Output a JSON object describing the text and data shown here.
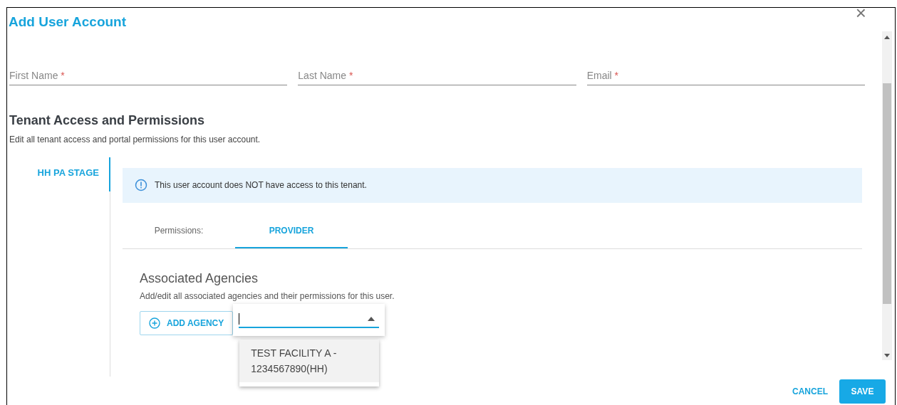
{
  "dialog": {
    "title": "Add User Account",
    "close_label": "×"
  },
  "fields": [
    {
      "label": "First Name",
      "required_mark": "*"
    },
    {
      "label": "Last Name",
      "required_mark": "*"
    },
    {
      "label": "Email",
      "required_mark": "*"
    }
  ],
  "section": {
    "title": "Tenant Access and Permissions",
    "description": "Edit all tenant access and portal permissions for this user account."
  },
  "tenants": [
    {
      "label": "HH PA STAGE",
      "selected": true
    }
  ],
  "notice": "This user account does NOT have access to this tenant.",
  "permission_tabs": {
    "caption": "Permissions:",
    "tabs": [
      {
        "label": "PROVIDER",
        "selected": true
      }
    ]
  },
  "agencies": {
    "title": "Associated Agencies",
    "description": "Add/edit all associated agencies and their permissions for this user.",
    "add_button": "ADD AGENCY",
    "options": [
      {
        "label": "TEST FACILITY A - 1234567890(HH)",
        "selected": true
      }
    ]
  },
  "buttons": {
    "cancel": "CANCEL",
    "save": "SAVE"
  }
}
